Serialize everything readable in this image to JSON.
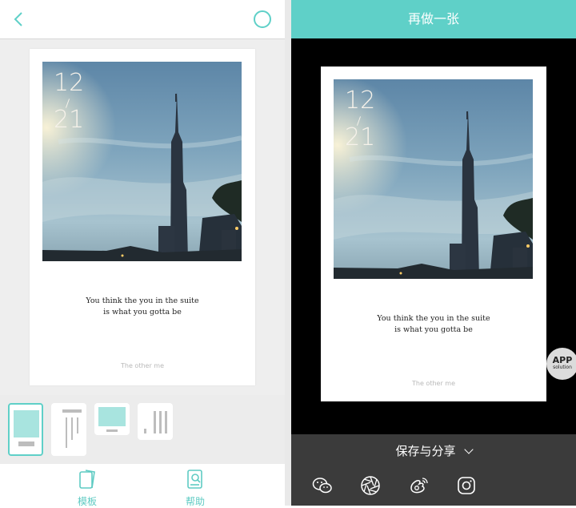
{
  "left": {
    "card": {
      "date_day": "12",
      "date_month": "21",
      "caption_line1": "You think the you in the suite",
      "caption_line2": "is what you gotta be",
      "signature": "The other me"
    },
    "tabs": [
      {
        "label": "模板",
        "icon": "template-icon"
      },
      {
        "label": "帮助",
        "icon": "help-book-icon"
      }
    ],
    "templates": [
      {
        "name": "template-photo-top",
        "selected": true
      },
      {
        "name": "template-vertical-lines",
        "selected": false
      },
      {
        "name": "template-landscape",
        "selected": false
      },
      {
        "name": "template-side-lines",
        "selected": false
      }
    ]
  },
  "right": {
    "header_title": "再做一张",
    "card": {
      "date_day": "12",
      "date_month": "21",
      "caption_line1": "You think the you in the suite",
      "caption_line2": "is what you gotta be",
      "signature": "The other me"
    },
    "save_share_label": "保存与分享",
    "share_targets": [
      "wechat-icon",
      "moments-icon",
      "weibo-icon",
      "instagram-icon"
    ]
  },
  "watermark": {
    "line1": "APP",
    "line2": "solution"
  },
  "colors": {
    "accent": "#5fd0c8",
    "right_background": "#000000",
    "bottom_bar": "#3b3b3b",
    "canvas": "#eeeeee"
  }
}
